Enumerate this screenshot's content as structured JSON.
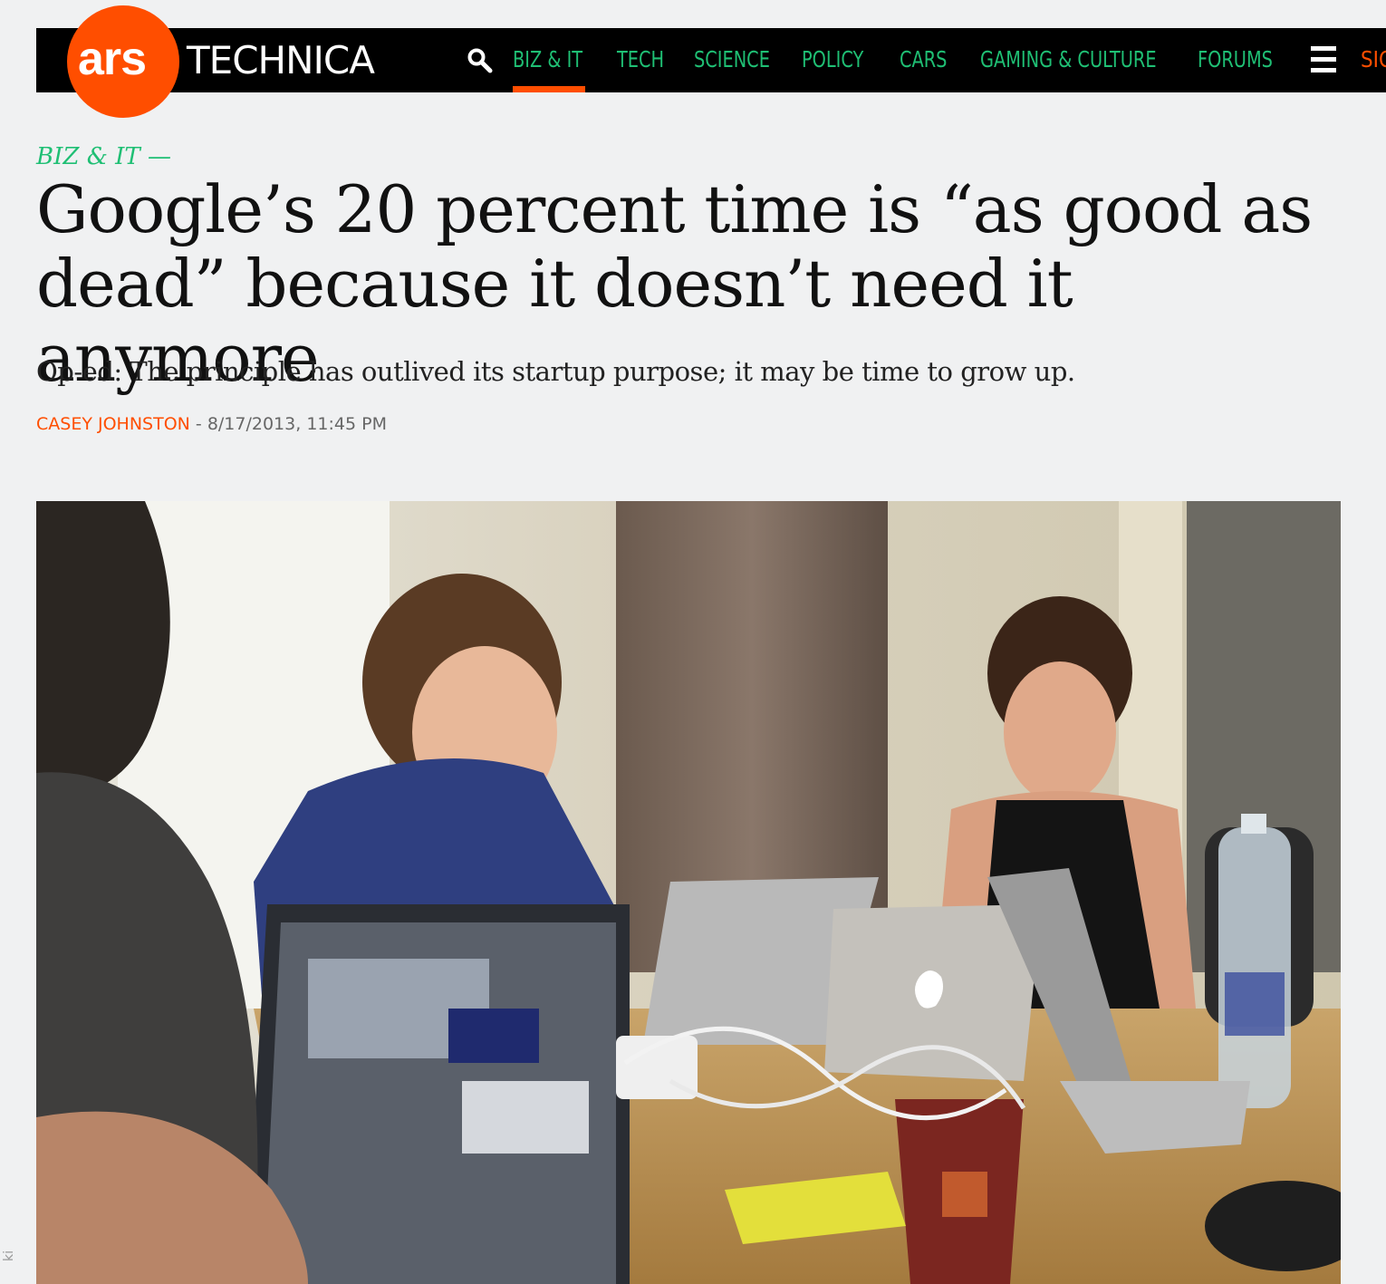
{
  "brand": {
    "logo_ars": "ars",
    "logo_technica": "TECHNICA",
    "accent_orange": "#ff4e00",
    "accent_green": "#1fbf74"
  },
  "nav": {
    "items": [
      {
        "label": "BIZ & IT",
        "active": true
      },
      {
        "label": "TECH",
        "active": false
      },
      {
        "label": "SCIENCE",
        "active": false
      },
      {
        "label": "POLICY",
        "active": false
      },
      {
        "label": "CARS",
        "active": false
      },
      {
        "label": "GAMING & CULTURE",
        "active": false
      },
      {
        "label": "FORUMS",
        "active": false
      }
    ],
    "signin_partial": "SIG",
    "icons": [
      "search-icon",
      "menu-icon"
    ]
  },
  "article": {
    "kicker": "BIZ & IT —",
    "headline": "Google’s 20 percent time is “as good as dead” because it doesn’t need it anymore",
    "dek": "Op-ed: The principle has outlived its startup purpose; it may be time to grow up.",
    "author": "CASEY JOHNSTON",
    "separator": " - ",
    "timestamp": "8/17/2013, 11:45 PM",
    "credit_fragment": "ki"
  }
}
